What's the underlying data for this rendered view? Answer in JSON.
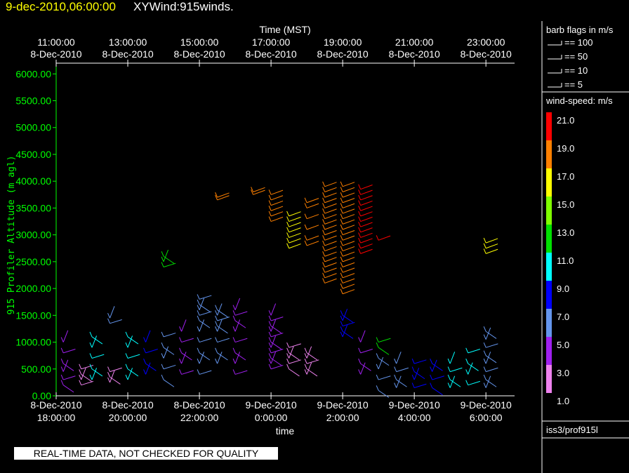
{
  "header": {
    "date": "9-dec-2010,06:00:00",
    "title": "XYWind:915winds."
  },
  "legend": {
    "barb_title": "barb flags in m/s",
    "barb_items": [
      "== 100",
      "== 50",
      "== 10",
      "== 5"
    ],
    "speed_title": "wind-speed: m/s",
    "speed_labels": [
      "21.0",
      "19.0",
      "17.0",
      "15.0",
      "13.0",
      "11.0",
      "9.0",
      "7.0",
      "5.0",
      "3.0",
      "1.0"
    ],
    "speed_colors": [
      "#ff0000",
      "#ff8000",
      "#ffff00",
      "#80ff00",
      "#00e000",
      "#00ffff",
      "#0000ff",
      "#6495ed",
      "#a020f0",
      "#ee82ee"
    ],
    "station": "iss3/prof915l"
  },
  "notice": "REAL-TIME DATA, NOT CHECKED FOR QUALITY",
  "chart_data": {
    "type": "scatter",
    "top_axis_title": "Time (MST)",
    "top_ticks": [
      {
        "time": "11:00:00",
        "date": "8-Dec-2010"
      },
      {
        "time": "13:00:00",
        "date": "8-Dec-2010"
      },
      {
        "time": "15:00:00",
        "date": "8-Dec-2010"
      },
      {
        "time": "17:00:00",
        "date": "8-Dec-2010"
      },
      {
        "time": "19:00:00",
        "date": "8-Dec-2010"
      },
      {
        "time": "21:00:00",
        "date": "8-Dec-2010"
      },
      {
        "time": "23:00:00",
        "date": "8-Dec-2010"
      }
    ],
    "bottom_ticks": [
      {
        "date": "8-Dec-2010",
        "time": "18:00:00"
      },
      {
        "date": "8-Dec-2010",
        "time": "20:00:00"
      },
      {
        "date": "8-Dec-2010",
        "time": "22:00:00"
      },
      {
        "date": "9-Dec-2010",
        "time": "0:00:00"
      },
      {
        "date": "9-Dec-2010",
        "time": "2:00:00"
      },
      {
        "date": "9-Dec-2010",
        "time": "4:00:00"
      },
      {
        "date": "9-Dec-2010",
        "time": "6:00:00"
      }
    ],
    "xlabel": "time",
    "ylabel": "915 Profiler Altitude (m agl)",
    "xlim_hours": [
      18,
      30.8
    ],
    "ylim": [
      0,
      6200
    ],
    "y_ticks": [
      "0.00",
      "500.00",
      "1000.00",
      "1500.00",
      "2000.00",
      "2500.00",
      "3000.00",
      "3500.00",
      "4000.00",
      "4500.00",
      "5000.00",
      "5500.00",
      "6000.00"
    ],
    "axis_color": "#00ff00",
    "series": [
      {
        "t": 18.2,
        "alts": [
          1000,
          800,
          600,
          450,
          300,
          200
        ],
        "speed": 5
      },
      {
        "t": 18.7,
        "alts": [
          500,
          400,
          300,
          200
        ],
        "speed": 3
      },
      {
        "t": 19.0,
        "alts": [
          1100,
          900,
          700,
          500,
          300
        ],
        "speed": 11
      },
      {
        "t": 19.5,
        "alts": [
          1450,
          1350
        ],
        "speed": 8
      },
      {
        "t": 19.5,
        "alts": [
          450,
          350,
          250
        ],
        "speed": 2
      },
      {
        "t": 20.0,
        "alts": [
          1100,
          900,
          700,
          500,
          300
        ],
        "speed": 12
      },
      {
        "t": 20.5,
        "alts": [
          1000,
          800,
          600,
          400
        ],
        "speed": 9
      },
      {
        "t": 21.0,
        "alts": [
          1100,
          900,
          700,
          500,
          300
        ],
        "speed": 7
      },
      {
        "t": 21.0,
        "alts": [
          2600,
          2500,
          2400
        ],
        "speed": 13
      },
      {
        "t": 21.5,
        "alts": [
          1200,
          1000,
          800,
          600,
          400
        ],
        "speed": 6
      },
      {
        "t": 22.0,
        "alts": [
          1800,
          1700,
          1600,
          1500,
          1400,
          1200,
          1000,
          800,
          600,
          400
        ],
        "speed": 7
      },
      {
        "t": 22.5,
        "alts": [
          1600,
          1500,
          1400,
          1300,
          1200,
          1000,
          800,
          600
        ],
        "speed": 7
      },
      {
        "t": 23.0,
        "alts": [
          1600,
          1500,
          1400,
          1200,
          1000,
          800,
          600,
          400
        ],
        "speed": 6
      },
      {
        "t": 22.5,
        "alts": [
          3700,
          3650
        ],
        "speed": 19
      },
      {
        "t": 23.5,
        "alts": [
          3800,
          3750
        ],
        "speed": 20
      },
      {
        "t": 24.0,
        "alts": [
          3750,
          3650,
          3550,
          3450,
          3350,
          3250
        ],
        "speed": 19
      },
      {
        "t": 24.5,
        "alts": [
          3350,
          3250,
          3150,
          3050,
          2950,
          2850,
          2750
        ],
        "speed": 18
      },
      {
        "t": 25.0,
        "alts": [
          3600,
          3500,
          3300,
          3100,
          2900,
          2800
        ],
        "speed": 19
      },
      {
        "t": 25.5,
        "alts": [
          3900,
          3800,
          3700,
          3600,
          3500,
          3400,
          3300,
          3200,
          3100,
          3000,
          2900,
          2800,
          2700,
          2600,
          2500,
          2400,
          2300,
          2200,
          2100
        ],
        "speed": 20
      },
      {
        "t": 26.0,
        "alts": [
          3900,
          3800,
          3700,
          3600,
          3500,
          3400,
          3300,
          3200,
          3100,
          3000,
          2900,
          2800,
          2700,
          2600,
          2500,
          2400,
          2300,
          2200,
          2100,
          2000,
          1900
        ],
        "speed": 20
      },
      {
        "t": 26.5,
        "alts": [
          3850,
          3750,
          3650,
          3550,
          3450,
          3350,
          3250,
          3150,
          3050,
          2950,
          2850,
          2750,
          2650
        ],
        "speed": 21
      },
      {
        "t": 27.0,
        "alts": [
          2900
        ],
        "speed": 21
      },
      {
        "t": 30.0,
        "alts": [
          2850,
          2750,
          2650
        ],
        "speed": 18
      },
      {
        "t": 26.0,
        "alts": [
          1500,
          1400,
          1300,
          1200,
          1100
        ],
        "speed": 9
      },
      {
        "t": 24.0,
        "alts": [
          1500,
          1400,
          1300,
          1200,
          1100,
          1000,
          900,
          800,
          700,
          600,
          500
        ],
        "speed": 6
      },
      {
        "t": 24.5,
        "alts": [
          900,
          800,
          700,
          600,
          500
        ],
        "speed": 4
      },
      {
        "t": 25.0,
        "alts": [
          800,
          700,
          600,
          500,
          400
        ],
        "speed": 4
      },
      {
        "t": 26.5,
        "alts": [
          1000,
          800,
          600,
          400
        ],
        "speed": 5
      },
      {
        "t": 27.0,
        "alts": [
          1000,
          900
        ],
        "speed": 13
      },
      {
        "t": 27.0,
        "alts": [
          700,
          500,
          300,
          100
        ],
        "speed": 7
      },
      {
        "t": 27.5,
        "alts": [
          600,
          450,
          300,
          150
        ],
        "speed": 8
      },
      {
        "t": 28.0,
        "alts": [
          600,
          450,
          300,
          150
        ],
        "speed": 9
      },
      {
        "t": 28.5,
        "alts": [
          600,
          450,
          300,
          150
        ],
        "speed": 10
      },
      {
        "t": 29.0,
        "alts": [
          600,
          450,
          300,
          150
        ],
        "speed": 11
      },
      {
        "t": 29.5,
        "alts": [
          800,
          600,
          400,
          200
        ],
        "speed": 12
      },
      {
        "t": 30.0,
        "alts": [
          1200,
          1050,
          900,
          750,
          600,
          450,
          300,
          150
        ],
        "speed": 7
      }
    ]
  }
}
